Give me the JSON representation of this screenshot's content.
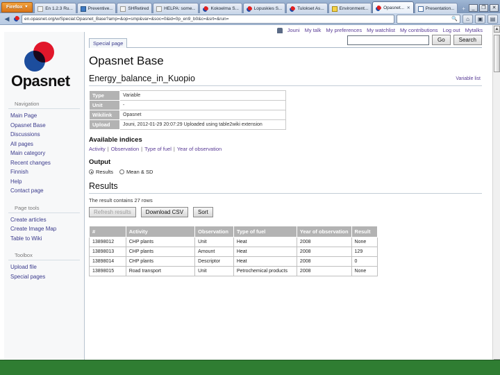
{
  "browser": {
    "firefox_button": "Firefox",
    "caret": "▾",
    "tabs": [
      {
        "label": "En 1.2.3 Ru...",
        "favicon": "doc-icon",
        "active": false
      },
      {
        "label": "Preventive...",
        "favicon": "blue-icon",
        "active": false
      },
      {
        "label": "SHRetired",
        "favicon": "doc-icon",
        "active": false
      },
      {
        "label": "HELPA: some...",
        "favicon": "doc-icon",
        "active": false
      },
      {
        "label": "Kokoelma S...",
        "favicon": "opasnet-icon",
        "active": false
      },
      {
        "label": "Lopuskies S...",
        "favicon": "opasnet-icon",
        "active": false
      },
      {
        "label": "Tulokset As...",
        "favicon": "opasnet-icon",
        "active": false
      },
      {
        "label": "Environment...",
        "favicon": "warn-icon",
        "active": false
      },
      {
        "label": "Opasnet...",
        "favicon": "opasnet-icon",
        "active": true
      },
      {
        "label": "Presentation...",
        "favicon": "grid-icon",
        "active": false
      }
    ],
    "close_glyph": "✕",
    "new_tab_glyph": "+",
    "window_controls": [
      "_",
      "❐",
      "✕"
    ],
    "back_glyph": "◀",
    "forward_glyph": "▶",
    "url": "en.opasnet.org/w/Special:Opasnet_Base?amp=&op=smp&var=&soc=0&id=0p_en9_b0&c=&srt=&run=",
    "search_placeholder": "",
    "search_icon": "search-icon",
    "home_icon": "home-icon",
    "bookmark_icon": "bookmark-icon",
    "feed_icon": "feed-icon"
  },
  "personal_bar": {
    "user_icon": "user-icon",
    "username": "Jouni",
    "links": [
      "My talk",
      "My preferences",
      "My watchlist",
      "My contributions",
      "Log out",
      "Mytalks"
    ]
  },
  "sidebar": {
    "logo_text": "Opasnet",
    "navigation_heading": "Navigation",
    "navigation": [
      "Main Page",
      "Opasnet Base",
      "Discussions",
      "All pages",
      "Main category",
      "Recent changes",
      "Finnish",
      "Help",
      "Contact page"
    ],
    "page_tools_heading": "Page tools",
    "page_tools": [
      "Create articles",
      "Create Image Map",
      "Table to Wiki"
    ],
    "toolbox_heading": "Toolbox",
    "toolbox": [
      "Upload file",
      "Special pages"
    ]
  },
  "content": {
    "tab_label": "Special page",
    "search_value": "",
    "go_label": "Go",
    "search_label": "Search",
    "page_title": "Opasnet Base",
    "variable_name": "Energy_balance_in_Kuopio",
    "variable_list_link": "Variable list",
    "meta_rows": [
      {
        "label": "Type",
        "value": "Variable"
      },
      {
        "label": "Unit",
        "value": "-"
      },
      {
        "label": "Wikilink",
        "value": "Opasnet"
      },
      {
        "label": "Upload",
        "value": "Jouni, 2012-01-29 20:07:29  Uploaded using table2wiki extension"
      }
    ],
    "indices_heading": "Available indices",
    "indices": [
      "Activity",
      "Observation",
      "Type of fuel",
      "Year of observation"
    ],
    "indices_separator": "|",
    "output_heading": "Output",
    "output_options": [
      {
        "label": "Results",
        "selected": true
      },
      {
        "label": "Mean & SD",
        "selected": false
      }
    ],
    "results_heading": "Results",
    "row_count_text": "The result contains 27 rows",
    "buttons": [
      {
        "label": "Refresh results",
        "disabled": true
      },
      {
        "label": "Download CSV",
        "disabled": false
      },
      {
        "label": "Sort",
        "disabled": false
      }
    ],
    "table": {
      "columns": [
        "#",
        "Activity",
        "Observation",
        "Type of fuel",
        "Year of observation",
        "Result"
      ],
      "rows": [
        [
          "13898012",
          "CHP plants",
          "Unit",
          "Heat",
          "2008",
          "None"
        ],
        [
          "13898013",
          "CHP plants",
          "Amount",
          "Heat",
          "2008",
          "129"
        ],
        [
          "13898014",
          "CHP plants",
          "Descriptor",
          "Heat",
          "2008",
          "0"
        ],
        [
          "13898015",
          "Road transport",
          "Unit",
          "Petrochemical products",
          "2008",
          "None"
        ]
      ]
    }
  }
}
